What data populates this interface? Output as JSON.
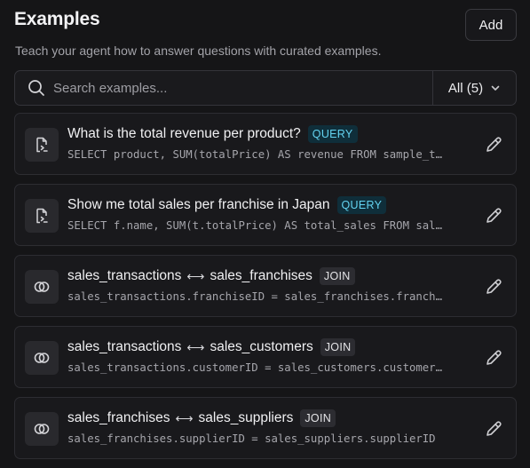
{
  "header": {
    "title": "Examples",
    "subtitle": "Teach your agent how to answer questions with curated examples.",
    "add_label": "Add"
  },
  "search": {
    "placeholder": "Search examples...",
    "value": "",
    "filter_label": "All (5)"
  },
  "colors": {
    "background": "#151517",
    "card": "#19191c",
    "query_badge_text": "#63d3f0",
    "query_badge_bg": "#0f2e3a"
  },
  "examples": [
    {
      "icon": "sql-file-icon",
      "title": "What is the total revenue per product?",
      "badge": "QUERY",
      "subtitle": "SELECT product, SUM(totalPrice) AS revenue FROM sample_table GROUP BY product"
    },
    {
      "icon": "sql-file-icon",
      "title": "Show me total sales per franchise in Japan",
      "badge": "QUERY",
      "subtitle": "SELECT f.name, SUM(t.totalPrice) AS total_sales FROM sales_transactions t JOIN sales_franchises f"
    },
    {
      "icon": "join-icon",
      "title_left": "sales_transactions",
      "title_right": "sales_franchises",
      "badge": "JOIN",
      "subtitle": "sales_transactions.franchiseID = sales_franchises.franchiseID"
    },
    {
      "icon": "join-icon",
      "title_left": "sales_transactions",
      "title_right": "sales_customers",
      "badge": "JOIN",
      "subtitle": "sales_transactions.customerID = sales_customers.customerID"
    },
    {
      "icon": "join-icon",
      "title_left": "sales_franchises",
      "title_right": "sales_suppliers",
      "badge": "JOIN",
      "subtitle": "sales_franchises.supplierID = sales_suppliers.supplierID"
    }
  ]
}
